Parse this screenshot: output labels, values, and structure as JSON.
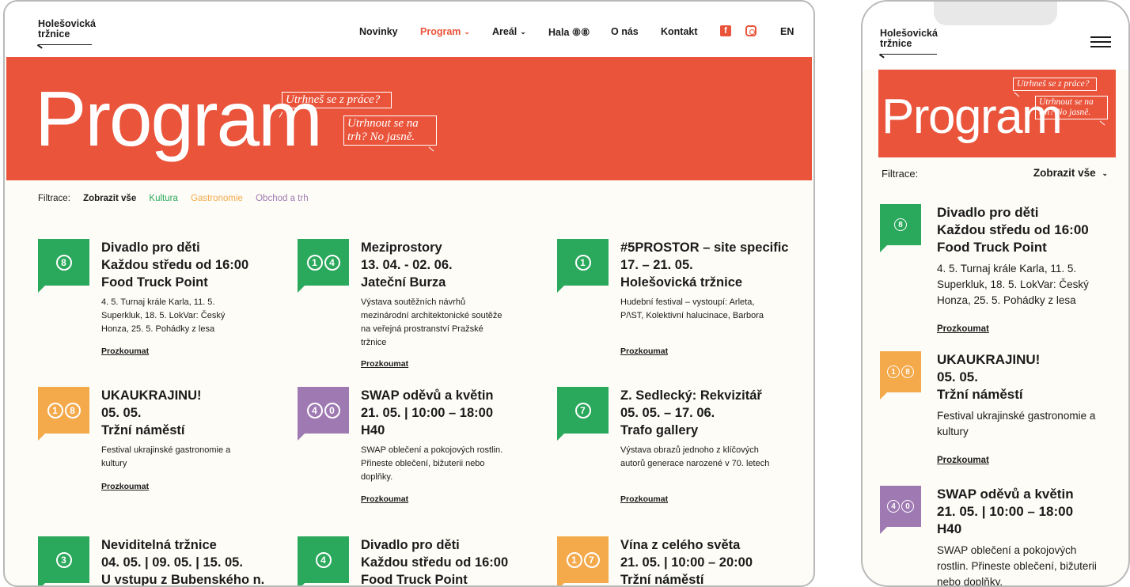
{
  "logo": {
    "line1": "Holešovická",
    "line2": "tržnice"
  },
  "nav": {
    "items": [
      "Novinky",
      "Program",
      "Areál",
      "Hala ⑧⑧",
      "O nás",
      "Kontakt"
    ],
    "chevron": "⌄",
    "lang": "EN",
    "social": [
      "facebook-icon",
      "instagram-icon"
    ],
    "facebook_glyph": "f"
  },
  "hero": {
    "title": "Program",
    "bubble1": "Utrhneš se z práce?",
    "bubble2": "Utrhnout se na trh? No jasně."
  },
  "filter": {
    "label": "Filtrace:",
    "options": [
      "Zobrazit vše",
      "Kultura",
      "Gastronomie",
      "Obchod a trh"
    ],
    "mobile_value": "Zobrazit vše",
    "mobile_chevron": "⌄"
  },
  "colors": {
    "accent": "#e9543b",
    "kultura": "#2aa85c",
    "gastronomie": "#f4a94b",
    "obchod": "#9f7ab2",
    "background": "#fdfcf6"
  },
  "link_label": "Prozkoumat",
  "events": [
    {
      "digits": [
        "8"
      ],
      "color": "green",
      "title": "Divadlo pro děti\nKaždou středu od 16:00\nFood Truck Point",
      "desc": "4. 5. Turnaj krále Karla, 11. 5. Superkluk, 18. 5. LokVar: Český Honza, 25. 5. Pohádky z lesa"
    },
    {
      "digits": [
        "1",
        "4"
      ],
      "color": "green",
      "title": "Meziprostory\n13. 04. - 02. 06.\nJateční Burza",
      "desc": "Výstava soutěžních návrhů mezinárodní architektonické soutěže na veřejná prostranství Pražské tržnice"
    },
    {
      "digits": [
        "1"
      ],
      "color": "green",
      "title": "#5PROSTOR – site specific\n17. – 21. 05.\nHolešovická tržnice",
      "desc": "Hudební festival – vystoupí: Arleta, P/\\ST, Kolektivní halucinace, Barbora"
    },
    {
      "digits": [
        "1",
        "8"
      ],
      "color": "orange",
      "title": "UKAUKRAJINU!\n05. 05.\nTržní náměstí",
      "desc": "Festival ukrajinské gastronomie a kultury"
    },
    {
      "digits": [
        "4",
        "0"
      ],
      "color": "purple",
      "title": "SWAP oděvů a květin\n21. 05. | 10:00 – 18:00\nH40",
      "desc": "SWAP oblečení a pokojových rostlin. Přineste oblečení, bižuterii nebo doplňky."
    },
    {
      "digits": [
        "7"
      ],
      "color": "green",
      "title": "Z. Sedlecký: Rekvizitář\n05. 05. – 17. 06.\nTrafo gallery",
      "desc": "Výstava obrazů jednoho z klíčových autorů generace narozené v 70. letech"
    },
    {
      "digits": [
        "3"
      ],
      "color": "green",
      "title": "Neviditelná tržnice\n04. 05. | 09. 05. | 15. 05.\nU vstupu z Bubenského n.",
      "desc": ""
    },
    {
      "digits": [
        "4"
      ],
      "color": "green",
      "title": "Divadlo pro děti\nKaždou středu od 16:00\nFood Truck Point",
      "desc": ""
    },
    {
      "digits": [
        "1",
        "7"
      ],
      "color": "orange",
      "title": "Vína z celého světa\n21. 05. | 10:00 – 20:00\nTržní náměstí",
      "desc": ""
    }
  ],
  "mobile_events": [
    {
      "digits": [
        "8"
      ],
      "color": "green",
      "title": "Divadlo pro děti\nKaždou středu od 16:00\nFood Truck Point",
      "desc": "4. 5. Turnaj krále Karla, 11. 5. Superkluk, 18. 5. LokVar: Český Honza, 25. 5. Pohádky z lesa"
    },
    {
      "digits": [
        "1",
        "8"
      ],
      "color": "orange",
      "title": "UKAUKRAJINU!\n05. 05.\nTržní náměstí",
      "desc": "Festival ukrajinské gastronomie a kultury"
    },
    {
      "digits": [
        "4",
        "0"
      ],
      "color": "purple",
      "title": "SWAP oděvů a květin\n21. 05. | 10:00 – 18:00\nH40",
      "desc": "SWAP oblečení a pokojových rostlin. Přineste oblečení, bižuterii nebo doplňky."
    }
  ]
}
